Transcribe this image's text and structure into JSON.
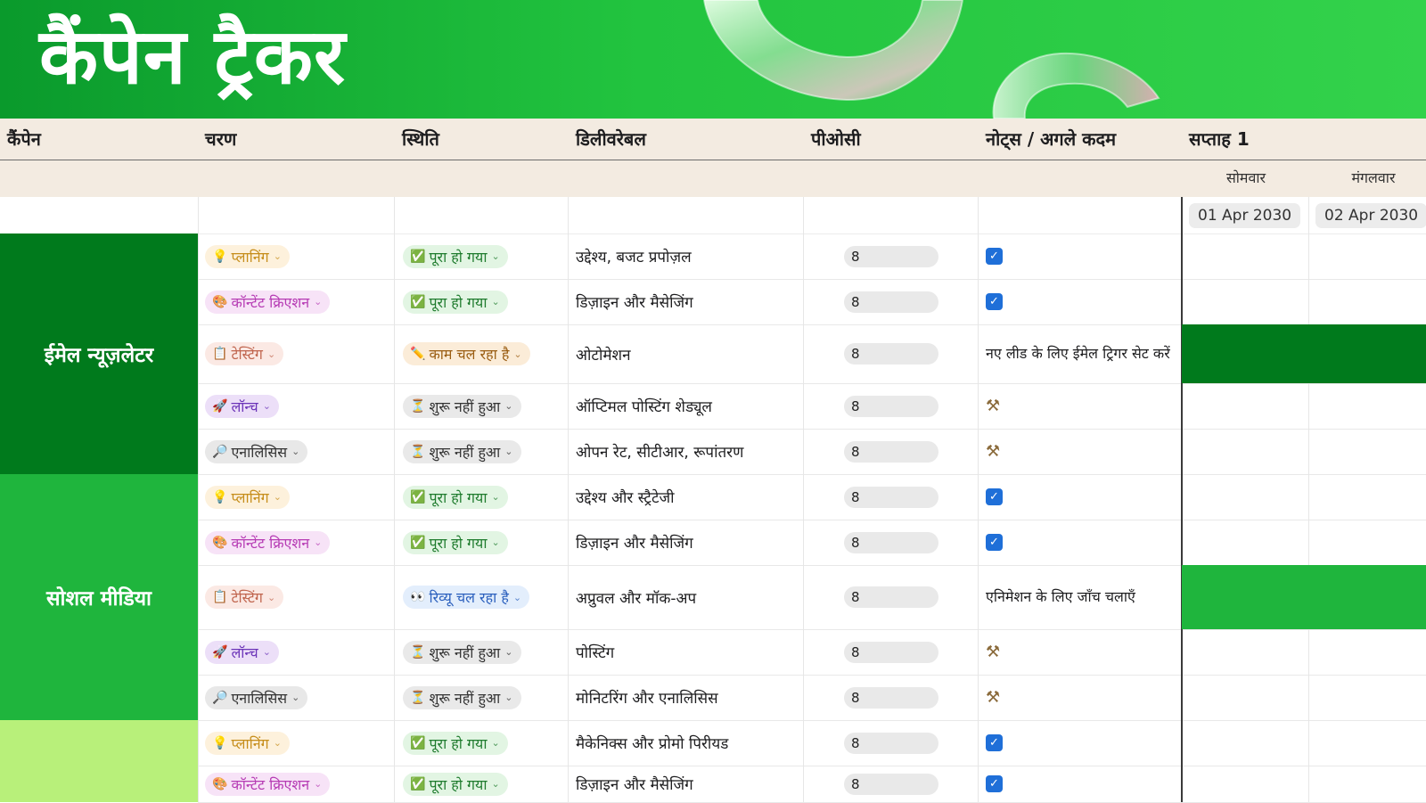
{
  "title": "कैंपेन ट्रैकर",
  "columns": {
    "campaign": "कैंपेन",
    "phase": "चरण",
    "status": "स्थिति",
    "deliverable": "डिलीवरेबल",
    "poc": "पीओसी",
    "notes": "नोट्स / अगले कदम",
    "week": "सप्ताह 1"
  },
  "days": [
    {
      "name": "सोमवार",
      "date": "01 Apr 2030"
    },
    {
      "name": "मंगलवार",
      "date": "02 Apr 2030"
    }
  ],
  "colors": {
    "banner": "#22c43f",
    "email_block": "#007a1c",
    "social_block": "#1fb53d",
    "third_block": "#b8f07a",
    "checkbox": "#1f6fd8"
  },
  "campaigns": [
    {
      "name": "ईमेल न्यूज़लेटर",
      "color": "#007a1c"
    },
    {
      "name": "सोशल मीडिया",
      "color": "#1fb53d"
    },
    {
      "name": "",
      "color": "#b8f07a"
    }
  ],
  "rows": [
    {
      "phase": "प्लानिंग",
      "phase_icon": "lightbulb-icon",
      "status": "पूरा हो गया",
      "status_icon": "check-box-icon",
      "deliverable": "उद्देश्य, बजट प्रपोज़ल",
      "poc": "8",
      "note_type": "checkbox",
      "note": ""
    },
    {
      "phase": "कॉन्टेंट क्रिएशन",
      "phase_icon": "palette-icon",
      "status": "पूरा हो गया",
      "status_icon": "check-box-icon",
      "deliverable": "डिज़ाइन और मैसेजिंग",
      "poc": "8",
      "note_type": "checkbox",
      "note": ""
    },
    {
      "phase": "टेस्टिंग",
      "phase_icon": "clipboard-icon",
      "status": "काम चल रहा है",
      "status_icon": "pencil-icon",
      "deliverable": "ओटोमेशन",
      "poc": "8",
      "note_type": "text",
      "note": "नए लीड के लिए ईमेल ट्रिगर सेट करें"
    },
    {
      "phase": "लॉन्च",
      "phase_icon": "rocket-icon",
      "status": "शुरू नहीं हुआ",
      "status_icon": "hourglass-icon",
      "deliverable": "ऑप्टिमल पोस्टिंग शेड्यूल",
      "poc": "8",
      "note_type": "tools",
      "note": ""
    },
    {
      "phase": "एनालिसिस",
      "phase_icon": "magnifier-icon",
      "status": "शुरू नहीं हुआ",
      "status_icon": "hourglass-icon",
      "deliverable": "ओपन रेट, सीटीआर, रूपांतरण",
      "poc": "8",
      "note_type": "tools",
      "note": ""
    },
    {
      "phase": "प्लानिंग",
      "phase_icon": "lightbulb-icon",
      "status": "पूरा हो गया",
      "status_icon": "check-box-icon",
      "deliverable": "उद्देश्य और स्ट्रैटेजी",
      "poc": "8",
      "note_type": "checkbox",
      "note": ""
    },
    {
      "phase": "कॉन्टेंट क्रिएशन",
      "phase_icon": "palette-icon",
      "status": "पूरा हो गया",
      "status_icon": "check-box-icon",
      "deliverable": "डिज़ाइन और मैसेजिंग",
      "poc": "8",
      "note_type": "checkbox",
      "note": ""
    },
    {
      "phase": "टेस्टिंग",
      "phase_icon": "clipboard-icon",
      "status": "रिव्यू चल रहा है",
      "status_icon": "eyes-icon",
      "deliverable": "अप्रुवल और मॉक-अप",
      "poc": "8",
      "note_type": "text",
      "note": "एनिमेशन के लिए जाँच चलाएँ"
    },
    {
      "phase": "लॉन्च",
      "phase_icon": "rocket-icon",
      "status": "शुरू नहीं हुआ",
      "status_icon": "hourglass-icon",
      "deliverable": "पोस्टिंग",
      "poc": "8",
      "note_type": "tools",
      "note": ""
    },
    {
      "phase": "एनालिसिस",
      "phase_icon": "magnifier-icon",
      "status": "शुरू नहीं हुआ",
      "status_icon": "hourglass-icon",
      "deliverable": "मोनिटरिंग और एनालिसिस",
      "poc": "8",
      "note_type": "tools",
      "note": ""
    },
    {
      "phase": "प्लानिंग",
      "phase_icon": "lightbulb-icon",
      "status": "पूरा हो गया",
      "status_icon": "check-box-icon",
      "deliverable": "मैकेनिक्स और प्रोमो पिरीयड",
      "poc": "8",
      "note_type": "checkbox",
      "note": ""
    },
    {
      "phase": "कॉन्टेंट क्रिएशन",
      "phase_icon": "palette-icon",
      "status": "पूरा हो गया",
      "status_icon": "check-box-icon",
      "deliverable": "डिज़ाइन और मैसेजिंग",
      "poc": "8",
      "note_type": "checkbox",
      "note": ""
    }
  ]
}
